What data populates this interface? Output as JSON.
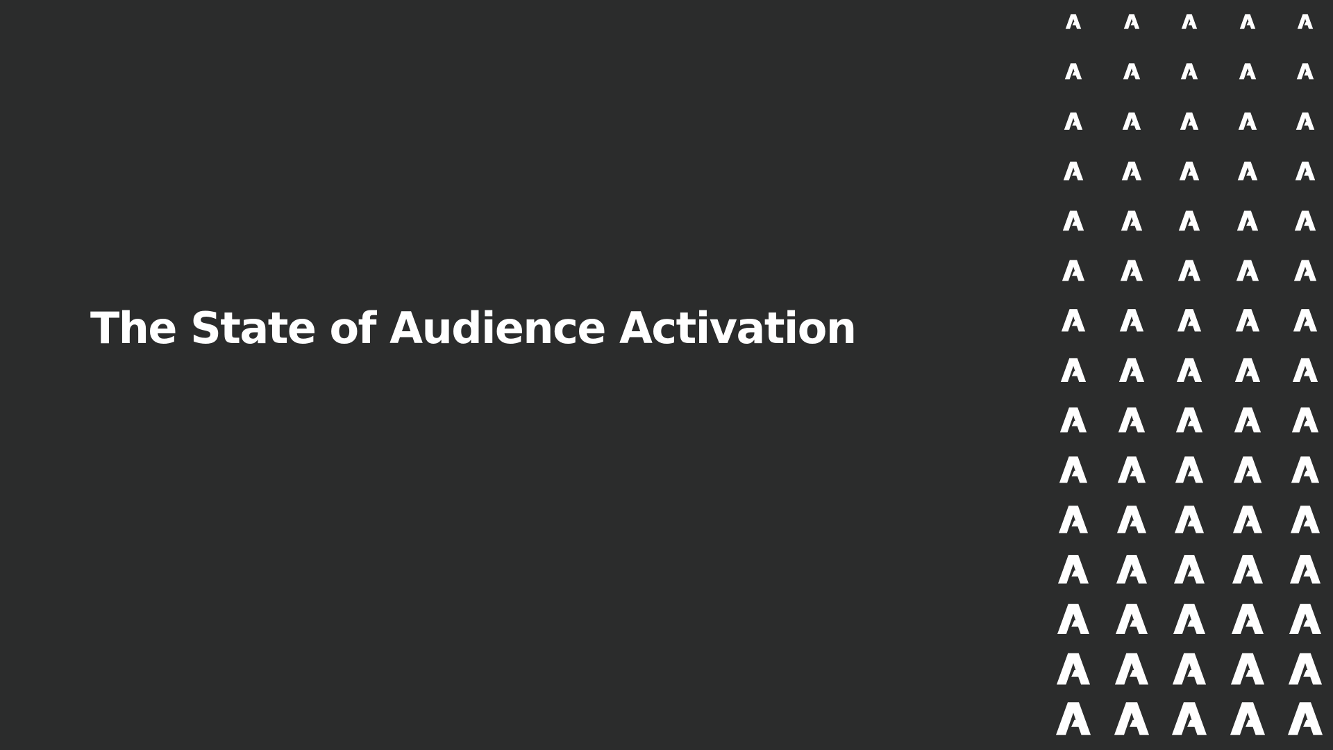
{
  "slide": {
    "title": "The State of Audience Activation",
    "background_color": "#2b2c2c",
    "text_color": "#ffffff"
  },
  "logo_pattern": {
    "icon": "adobe-a-logo-icon",
    "color": "#ffffff",
    "rows": 15,
    "columns": 5
  }
}
